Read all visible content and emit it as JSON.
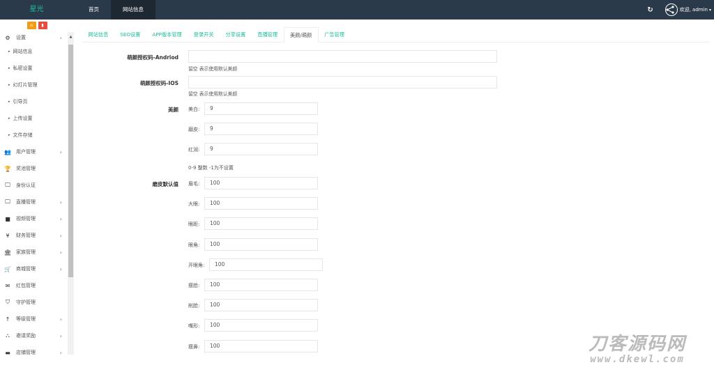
{
  "brand": "星光",
  "top_nav": [
    {
      "label": "首页",
      "active": false
    },
    {
      "label": "网站信息",
      "active": true
    }
  ],
  "user": {
    "greeting": "欢迎, admin",
    "caret": "▾",
    "refresh_icon": "↻"
  },
  "sidebar": {
    "shortcuts": [
      {
        "icon": "home-icon",
        "glyph": "⌂"
      },
      {
        "icon": "trash-icon",
        "glyph": "🗑"
      }
    ],
    "items": [
      {
        "label": "设置",
        "icon": "gears-icon",
        "glyph": "⚙",
        "has_arrow": true,
        "type": "top"
      },
      {
        "label": "网站信息",
        "type": "sub"
      },
      {
        "label": "私密设置",
        "type": "sub"
      },
      {
        "label": "幻灯片管理",
        "type": "sub"
      },
      {
        "label": "引导页",
        "type": "sub"
      },
      {
        "label": "上传设置",
        "type": "sub"
      },
      {
        "label": "文件存储",
        "type": "sub"
      },
      {
        "label": "用户管理",
        "icon": "users-icon",
        "glyph": "👥",
        "has_arrow": true
      },
      {
        "label": "奖池管理",
        "icon": "trophy-icon",
        "glyph": "🏆",
        "has_arrow": false
      },
      {
        "label": "身份认证",
        "icon": "monitor-icon",
        "glyph": "🖵",
        "has_arrow": false
      },
      {
        "label": "直播管理",
        "icon": "monitor-icon",
        "glyph": "🖵",
        "has_arrow": true
      },
      {
        "label": "视频管理",
        "icon": "video-camera-icon",
        "glyph": "■",
        "has_arrow": true
      },
      {
        "label": "财务管理",
        "icon": "yen-icon",
        "glyph": "¥",
        "has_arrow": true
      },
      {
        "label": "家族管理",
        "icon": "bank-icon",
        "glyph": "🏛",
        "has_arrow": true
      },
      {
        "label": "商城管理",
        "icon": "cart-icon",
        "glyph": "🛒",
        "has_arrow": true
      },
      {
        "label": "红包管理",
        "icon": "envelope-icon",
        "glyph": "✉",
        "has_arrow": false
      },
      {
        "label": "守护管理",
        "icon": "shield-icon",
        "glyph": "⛉",
        "has_arrow": false
      },
      {
        "label": "等级管理",
        "icon": "level-up-icon",
        "glyph": "↑",
        "has_arrow": true
      },
      {
        "label": "邀请奖励",
        "icon": "sitemap-icon",
        "glyph": "⛬",
        "has_arrow": true
      },
      {
        "label": "店铺管理",
        "icon": "store-icon",
        "glyph": "▬",
        "has_arrow": true
      }
    ],
    "arrow": "›"
  },
  "tabs": [
    {
      "label": "网站信息",
      "active": false
    },
    {
      "label": "SEO设置",
      "active": false
    },
    {
      "label": "APP版本管理",
      "active": false
    },
    {
      "label": "登录开关",
      "active": false
    },
    {
      "label": "分享设置",
      "active": false
    },
    {
      "label": "直播管理",
      "active": false
    },
    {
      "label": "美颜/萌颜",
      "active": true
    },
    {
      "label": "广告管理",
      "active": false
    }
  ],
  "form": {
    "android_key": {
      "label": "萌颜授权码-Andriod",
      "value": "",
      "hint": "留空 表示使用默认美颜"
    },
    "ios_key": {
      "label": "萌颜授权码-IOS",
      "value": "",
      "hint": "留空 表示使用默认美颜"
    },
    "beauty": {
      "label": "美颜",
      "fields": [
        {
          "label": "美白:",
          "value": "9"
        },
        {
          "label": "磨皮:",
          "value": "9"
        },
        {
          "label": "红润:",
          "value": "9"
        }
      ],
      "hint": "0-9 整数 -1为不设置"
    },
    "skin_defaults": {
      "label": "磨皮默认值",
      "fields": [
        {
          "label": "眉毛:",
          "value": "100"
        },
        {
          "label": "大眼:",
          "value": "100"
        },
        {
          "label": "眼距:",
          "value": "100"
        },
        {
          "label": "眼角:",
          "value": "100"
        },
        {
          "label": "开眼角:",
          "value": "100"
        },
        {
          "label": "瘦脸:",
          "value": "100"
        },
        {
          "label": "削脸:",
          "value": "100"
        },
        {
          "label": "嘴形:",
          "value": "100"
        },
        {
          "label": "瘦鼻:",
          "value": "100"
        }
      ]
    }
  },
  "watermark": {
    "line1": "刀客源码网",
    "line2": "www.dkewl.com"
  }
}
